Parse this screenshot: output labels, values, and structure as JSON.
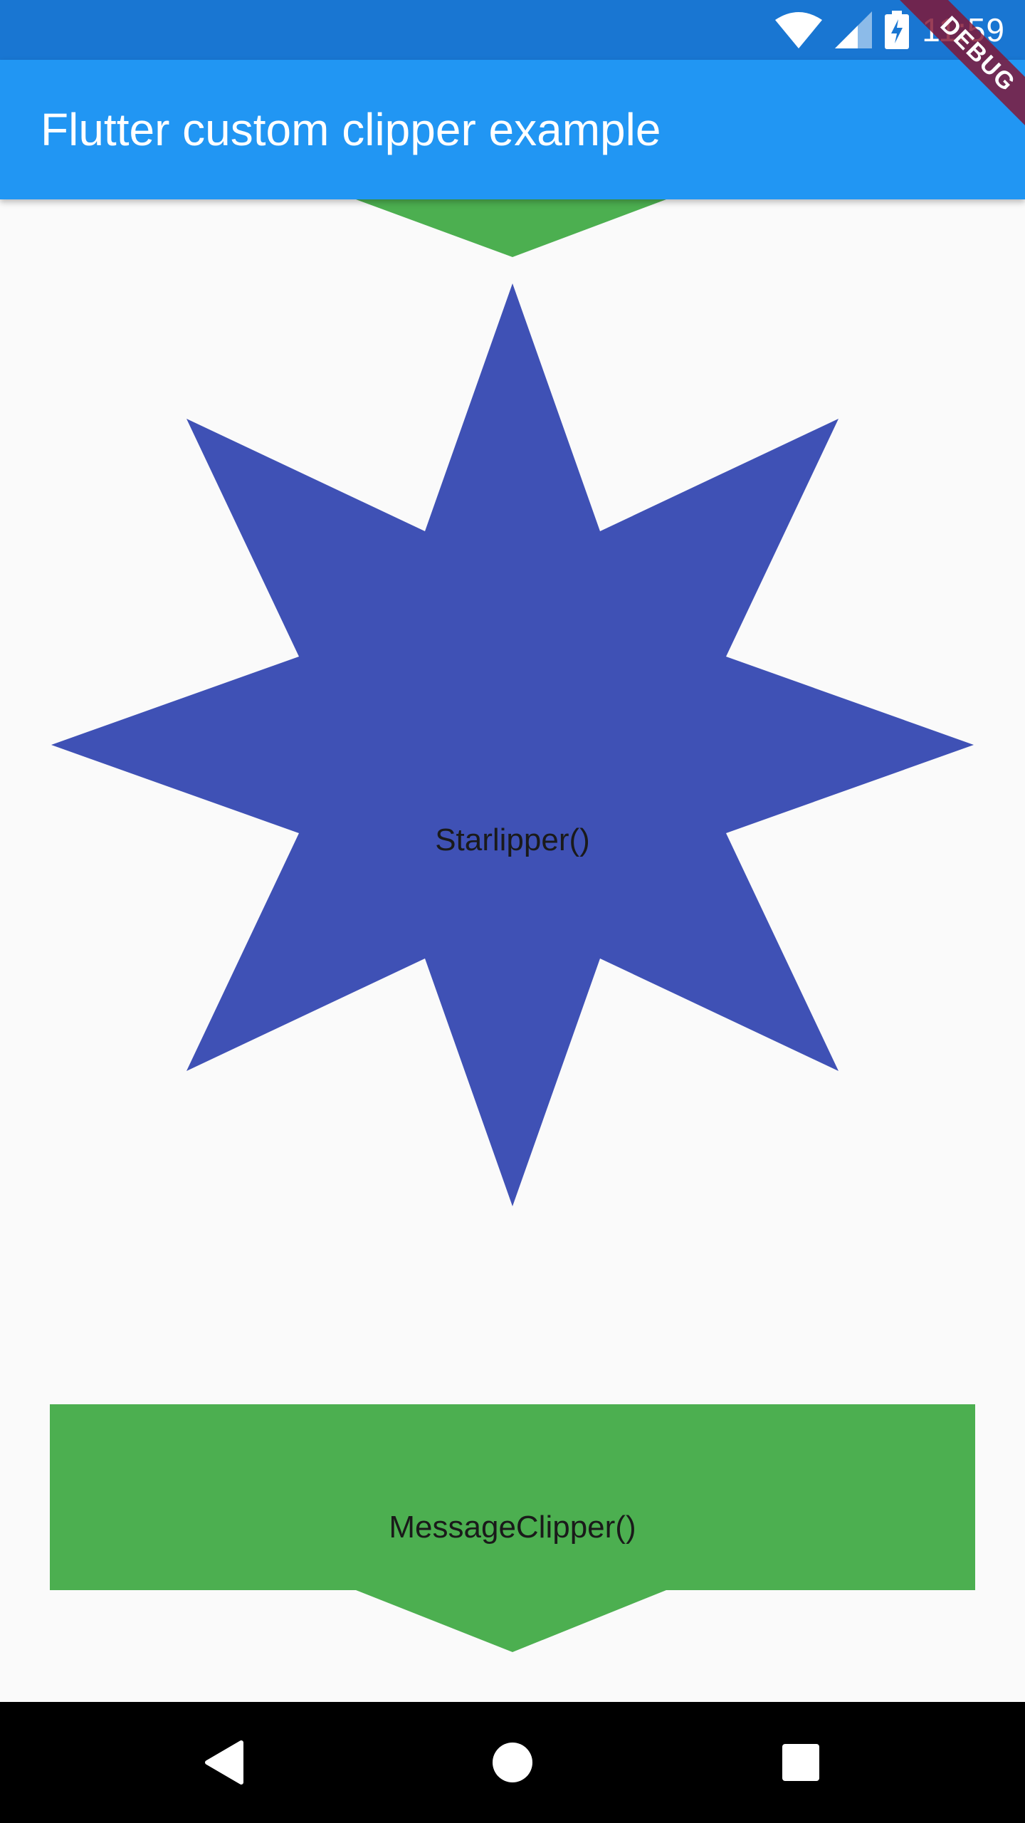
{
  "status_bar": {
    "time": "11:59",
    "icons": [
      "wifi-icon",
      "signal-icon",
      "battery-charging-icon"
    ]
  },
  "debug_banner": {
    "label": "DEBUG"
  },
  "app_bar": {
    "title": "Flutter custom clipper example"
  },
  "colors": {
    "status_bar": "#1976d2",
    "app_bar": "#2196f3",
    "star": "#3f51b5",
    "message": "#4caf50",
    "background": "#fafafa",
    "nav_bar": "#000000"
  },
  "star_clipper": {
    "label": "Starlipper()"
  },
  "message_clipper": {
    "label": "MessageClipper()"
  },
  "nav_bar": {
    "buttons": [
      "back-icon",
      "home-icon",
      "recents-icon"
    ]
  }
}
